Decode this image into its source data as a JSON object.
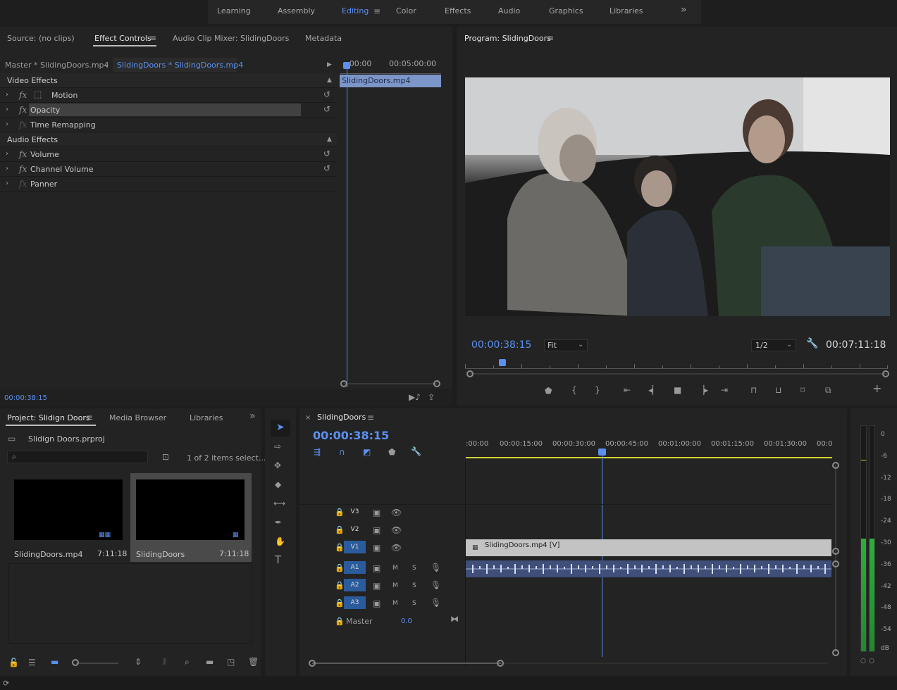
{
  "workspaces": [
    "Learning",
    "Assembly",
    "Editing",
    "Color",
    "Effects",
    "Audio",
    "Graphics",
    "Libraries"
  ],
  "workspace_active": "Editing",
  "source_panel": {
    "tabs": [
      "Source: (no clips)",
      "Effect Controls",
      "Audio Clip Mixer: SlidingDoors",
      "Metadata"
    ],
    "master_clip": "Master * SlidingDoors.mp4",
    "sequence_clip": "SlidingDoors * SlidingDoors.mp4",
    "timecode_start": ":00:00",
    "timecode_mid": "00:05:00:00",
    "clip_bar": "SlidingDoors.mp4",
    "video_effects_header": "Video Effects",
    "video_effects": [
      "Motion",
      "Opacity",
      "Time Remapping"
    ],
    "audio_effects_header": "Audio Effects",
    "audio_effects": [
      "Volume",
      "Channel Volume",
      "Panner"
    ],
    "timecode": "00:00:38:15"
  },
  "program_panel": {
    "title": "Program: SlidingDoors",
    "timecode": "00:00:38:15",
    "fit": "Fit",
    "resolution": "1/2",
    "duration": "00:07:11:18"
  },
  "project_panel": {
    "tabs": [
      "Project: Slidign Doors",
      "Media Browser",
      "Libraries"
    ],
    "project_file": "Slidign Doors.prproj",
    "selection": "1 of 2 items select...",
    "items": [
      {
        "name": "SlidingDoors.mp4",
        "duration": "7:11:18"
      },
      {
        "name": "SlidingDoors",
        "duration": "7:11:18"
      }
    ]
  },
  "timeline_panel": {
    "title": "SlidingDoors",
    "timecode": "00:00:38:15",
    "ruler": [
      ":00:00",
      "00:00:15:00",
      "00:00:30:00",
      "00:00:45:00",
      "00:01:00:00",
      "00:01:15:00",
      "00:01:30:00",
      "00:0"
    ],
    "video_tracks": [
      "V3",
      "V2",
      "V1"
    ],
    "audio_tracks": [
      "A1",
      "A2",
      "A3"
    ],
    "master_label": "Master",
    "master_value": "0.0",
    "video_clip": "SlidingDoors.mp4 [V]",
    "mute": "M",
    "solo": "S"
  },
  "meter": {
    "labels": [
      "0",
      "-6",
      "-12",
      "-18",
      "-24",
      "-30",
      "-36",
      "-42",
      "-48",
      "-54",
      "dB"
    ]
  },
  "colors": {
    "accent_blue": "#5b8ff0",
    "panel_bg": "#232323",
    "track_on": "#2a5b9c"
  }
}
